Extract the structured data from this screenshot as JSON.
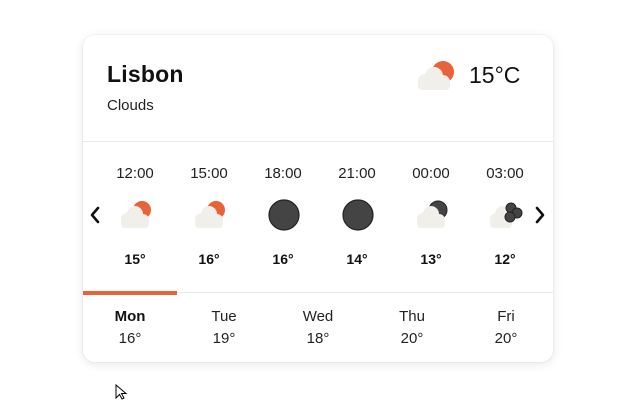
{
  "location": {
    "city": "Lisbon",
    "condition": "Clouds",
    "current_temp": "15°C",
    "current_icon": "partly-cloudy-day-icon"
  },
  "colors": {
    "accent": "#e8623a",
    "moon": "#444444",
    "cloud": "#f0efe9"
  },
  "hourly": [
    {
      "time": "12:00",
      "temp": "15°",
      "icon": "partly-cloudy-day-icon"
    },
    {
      "time": "15:00",
      "temp": "16°",
      "icon": "partly-cloudy-day-icon"
    },
    {
      "time": "18:00",
      "temp": "16°",
      "icon": "moon-icon"
    },
    {
      "time": "21:00",
      "temp": "14°",
      "icon": "moon-icon"
    },
    {
      "time": "00:00",
      "temp": "13°",
      "icon": "partly-cloudy-night-icon"
    },
    {
      "time": "03:00",
      "temp": "12°",
      "icon": "cloudy-night-icon"
    }
  ],
  "daily": [
    {
      "day": "Mon",
      "temp": "16°",
      "active": true
    },
    {
      "day": "Tue",
      "temp": "19°",
      "active": false
    },
    {
      "day": "Wed",
      "temp": "18°",
      "active": false
    },
    {
      "day": "Thu",
      "temp": "20°",
      "active": false
    },
    {
      "day": "Fri",
      "temp": "20°",
      "active": false
    }
  ]
}
